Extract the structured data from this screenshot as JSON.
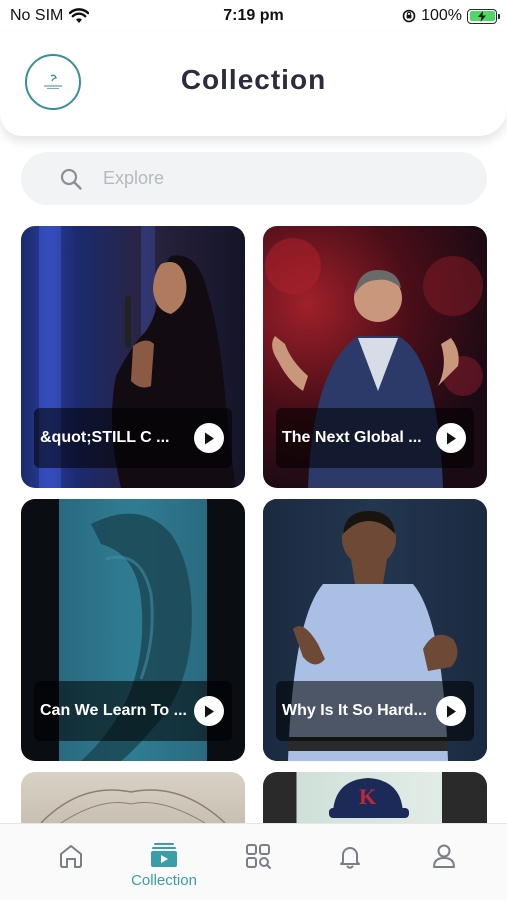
{
  "status_bar": {
    "carrier": "No SIM",
    "time": "7:19 pm",
    "battery": "100%"
  },
  "header": {
    "title": "Collection"
  },
  "search": {
    "placeholder": "Explore"
  },
  "cards": [
    {
      "title": "&quot;STILL C ..."
    },
    {
      "title": "The Next Global ..."
    },
    {
      "title": "Can We Learn To ..."
    },
    {
      "title": "Why Is It So Hard..."
    }
  ],
  "bottom_nav": {
    "items": [
      {
        "icon": "home-icon",
        "label": ""
      },
      {
        "icon": "collection-icon",
        "label": "Collection",
        "active": true
      },
      {
        "icon": "explore-grid-icon",
        "label": ""
      },
      {
        "icon": "bell-icon",
        "label": ""
      },
      {
        "icon": "profile-icon",
        "label": ""
      }
    ]
  },
  "colors": {
    "accent": "#3a9ea6",
    "title": "#2a2d3d"
  }
}
